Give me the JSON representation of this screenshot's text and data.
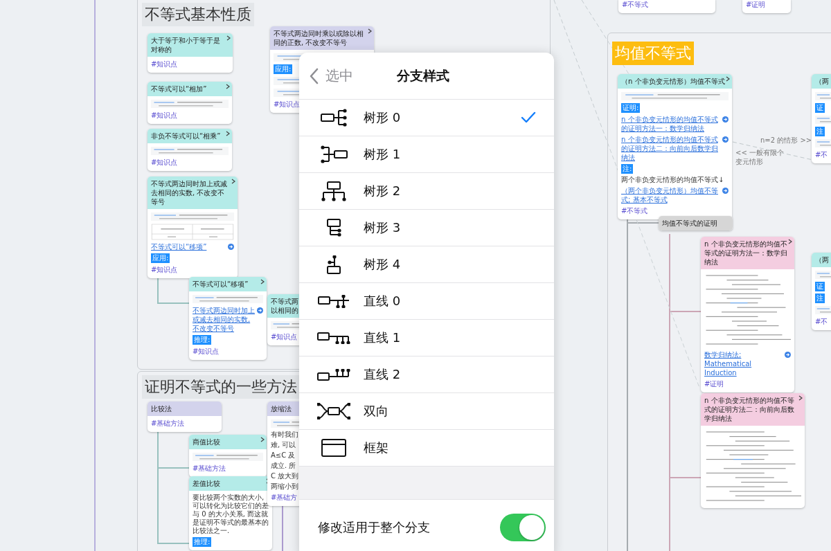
{
  "canvas": {
    "sections": [
      {
        "title": "不等式基本性质",
        "highlighted": false
      },
      {
        "title": "证明不等式的一些方法",
        "highlighted": false
      },
      {
        "title": "均值不等式",
        "highlighted": true
      }
    ],
    "nodes": [
      {
        "title": "大于等于和小于等于是对称的",
        "color": "#b4ebe8",
        "items": [
          {
            "kind": "tag",
            "text": "#知识点"
          }
        ]
      },
      {
        "title": "不等式可以“相加”",
        "color": "#b4ebe8",
        "items": [
          {
            "kind": "formula"
          },
          {
            "kind": "tag",
            "text": "#知识点"
          }
        ]
      },
      {
        "title": "非负不等式可以“相乘”",
        "color": "#b4ebe8",
        "items": [
          {
            "kind": "formula"
          },
          {
            "kind": "tag",
            "text": "#知识点"
          }
        ]
      },
      {
        "title": "不等式两边同时加上或减去相同的实数, 不改变不等号",
        "color": "#b4ebe8",
        "items": [
          {
            "kind": "formula"
          },
          {
            "kind": "table"
          },
          {
            "kind": "link",
            "text": "不等式可以“移项”"
          },
          {
            "kind": "label",
            "text": "应用:"
          },
          {
            "kind": "tag",
            "text": "#知识点"
          }
        ]
      },
      {
        "title": "不等式可以“移项”",
        "color": "#b4ebe8",
        "items": [
          {
            "kind": "formula"
          },
          {
            "kind": "link",
            "text": "不等式两边同时加上或减去相同的实数, 不改变不等号"
          },
          {
            "kind": "label",
            "text": "推理:"
          },
          {
            "kind": "tag",
            "text": "#知识点"
          }
        ]
      },
      {
        "title": "不等式两边同时乘以或除以相同的正数, 不改变不等号",
        "color": "#d3d3ec",
        "items": [
          {
            "kind": "formula"
          },
          {
            "kind": "label",
            "text": "应用:"
          },
          {
            "kind": "formula"
          },
          {
            "kind": "formula"
          },
          {
            "kind": "tag",
            "text": "#知识点"
          }
        ]
      },
      {
        "title": "不等式两以相同的",
        "color": "#b4ebe8",
        "items": [
          {
            "kind": "formula"
          },
          {
            "kind": "tag",
            "text": "#知识点"
          }
        ]
      },
      {
        "title": "比较法",
        "color": "#d3d3ec",
        "items": [
          {
            "kind": "tag",
            "text": "#基础方法"
          }
        ]
      },
      {
        "title": "商值比较",
        "color": "#b4ebe8",
        "items": [
          {
            "kind": "formula"
          },
          {
            "kind": "tag",
            "text": "#基础方法"
          }
        ]
      },
      {
        "title": "差值比较",
        "color": "#b4ebe8",
        "items": [
          {
            "kind": "text",
            "text": "要比较两个实数的大小, 可以转化为比较它们的差与 0 的大小关系, 而这就是证明不等式的最基本的比较法之一."
          },
          {
            "kind": "label",
            "text": "推理:"
          }
        ]
      },
      {
        "title": "放缩法",
        "color": "#d3d3ec",
        "items": [
          {
            "kind": "formula"
          },
          {
            "kind": "text",
            "text": "有时我们"
          },
          {
            "kind": "text",
            "text": "难, 可以"
          },
          {
            "kind": "text",
            "text": "A≤C 及"
          },
          {
            "kind": "text",
            "text": "成立. 所"
          },
          {
            "kind": "text",
            "text": "C 放大到"
          },
          {
            "kind": "text",
            "text": "两缩小到"
          },
          {
            "kind": "tag",
            "text": "#基础方"
          }
        ]
      },
      {
        "title": "（n 个非负变元情形）均值不等式",
        "color": "#b4ebe8",
        "items": [
          {
            "kind": "formula"
          },
          {
            "kind": "label",
            "text": "证明:"
          },
          {
            "kind": "link",
            "text": "n 个非负变元情形的均值不等式的证明方法一：数学归纳法"
          },
          {
            "kind": "link",
            "text": "n 个非负变元情形的均值不等式的证明方法二：向前向后数学归纳法"
          },
          {
            "kind": "label",
            "text": "注:"
          },
          {
            "kind": "text",
            "text": "两个非负变元情形的均值不等式↓"
          },
          {
            "kind": "link",
            "text": "（两个非负变元情形）均值不等式; 基本不等式"
          },
          {
            "kind": "tag",
            "text": "#不等式"
          }
        ]
      },
      {
        "title": "均值不等式的证明",
        "color": "#d6d6d6"
      },
      {
        "title": "n 个非负变元情形的均值不等式的证明方法一：数学归纳法",
        "color": "#f4cde0",
        "items": [
          {
            "kind": "derivation"
          },
          {
            "kind": "link",
            "text": "数学归纳法; Mathematical Induction"
          },
          {
            "kind": "tag",
            "text": "#证明"
          }
        ]
      },
      {
        "title": "n 个非负变元情形的均值不等式的证明方法二：向前向后数学归纳法",
        "color": "#f4cde0",
        "items": [
          {
            "kind": "derivation"
          }
        ]
      },
      {
        "title": "（两",
        "color": "#b4ebe8",
        "items": [
          {
            "kind": "formula"
          },
          {
            "kind": "label",
            "text": "证"
          },
          {
            "kind": "formula"
          },
          {
            "kind": "label",
            "text": "注"
          },
          {
            "kind": "formula"
          },
          {
            "kind": "tag",
            "text": "#不"
          }
        ]
      },
      {
        "title": "（两",
        "color": "#b4ebe8",
        "items": [
          {
            "kind": "formula"
          },
          {
            "kind": "label",
            "text": "证"
          },
          {
            "kind": "label",
            "text": "注"
          },
          {
            "kind": "formula"
          },
          {
            "kind": "tag",
            "text": "#不"
          }
        ]
      },
      {
        "items": [
          {
            "kind": "tag",
            "text": "#不等式"
          }
        ]
      },
      {
        "items": [
          {
            "kind": "tag",
            "text": "#证明"
          }
        ]
      }
    ],
    "edge_labels": [
      {
        "text": "<< 一般有限个变元情形"
      },
      {
        "text": "n=2 的情形 >>"
      }
    ]
  },
  "panel": {
    "back_label": "选中",
    "title": "分支样式",
    "options": [
      {
        "label": "树形 0",
        "kind": "tree-right",
        "selected": true
      },
      {
        "label": "树形 1",
        "kind": "tree-left",
        "selected": false
      },
      {
        "label": "树形 2",
        "kind": "org",
        "selected": false
      },
      {
        "label": "树形 3",
        "kind": "down-right",
        "selected": false
      },
      {
        "label": "树形 4",
        "kind": "down-left",
        "selected": false
      },
      {
        "label": "直线 0",
        "kind": "line-0",
        "selected": false
      },
      {
        "label": "直线 1",
        "kind": "line-1",
        "selected": false
      },
      {
        "label": "直线 2",
        "kind": "line-2",
        "selected": false
      },
      {
        "label": "双向",
        "kind": "both",
        "selected": false
      },
      {
        "label": "框架",
        "kind": "frame",
        "selected": false
      }
    ],
    "toggle": {
      "label": "修改适用于整个分支",
      "on": true
    }
  }
}
